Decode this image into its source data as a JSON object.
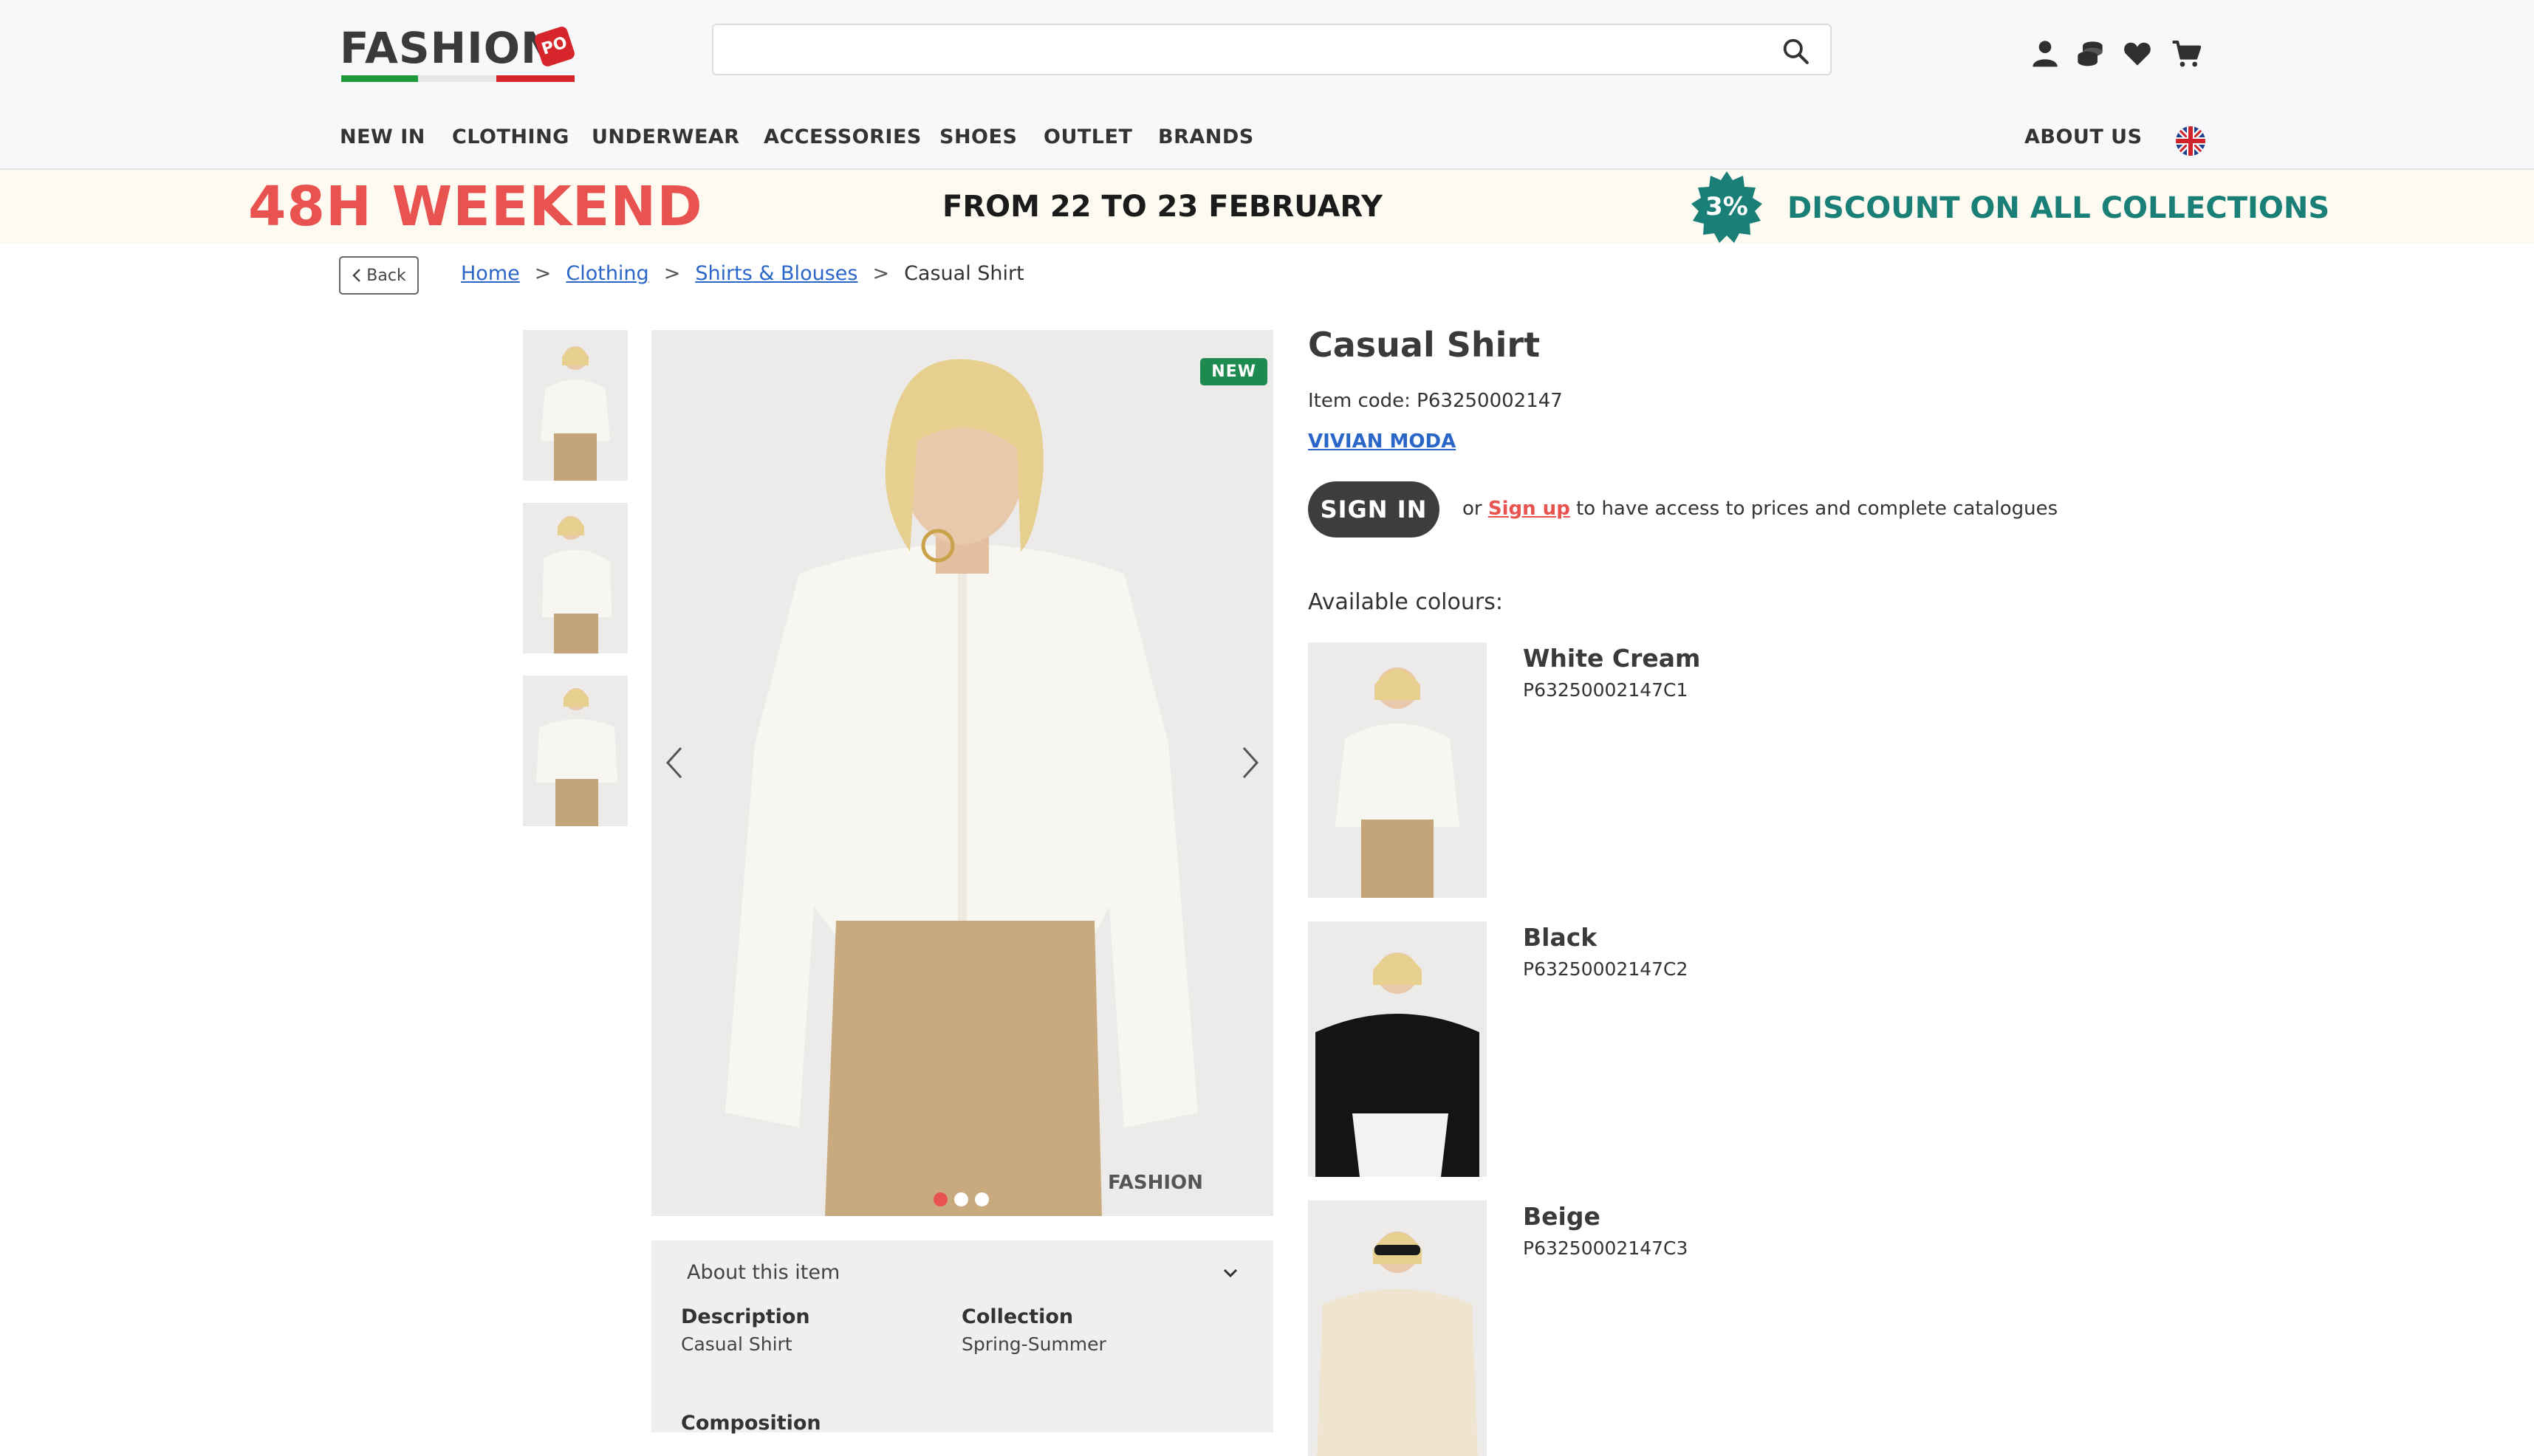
{
  "header": {
    "logo": {
      "text": "FASHION",
      "tag": "PO"
    },
    "search": {
      "placeholder": "",
      "value": ""
    },
    "icons": [
      "user-icon",
      "coins-icon",
      "heart-icon",
      "cart-icon"
    ],
    "nav": [
      "NEW IN",
      "CLOTHING",
      "UNDERWEAR",
      "ACCESSORIES",
      "SHOES",
      "OUTLET",
      "BRANDS"
    ],
    "about_us": "ABOUT US",
    "language_icon": "uk-flag-icon"
  },
  "promo": {
    "left": "48H WEEKEND",
    "middle": "FROM 22 TO 23 FEBRUARY",
    "badge": "3%",
    "right": "DISCOUNT ON ALL COLLECTIONS",
    "colors": {
      "left": "#e8534f",
      "right": "#1a7f77",
      "badge": "#1a7f77"
    }
  },
  "breadcrumb": {
    "back": "Back",
    "items": [
      "Home",
      "Clothing",
      "Shirts & Blouses",
      "Casual Shirt"
    ],
    "separator": ">"
  },
  "product": {
    "new_badge": "NEW",
    "watermark": "FASHION",
    "title": "Casual Shirt",
    "item_code": "Item code: P63250002147",
    "brand": "VIVIAN MODA",
    "signin": "SIGN IN",
    "signin_or": "or",
    "signup_link": "Sign up",
    "signin_suffix": "to have access to prices and complete catalogues",
    "colours_label": "Available colours:",
    "colours": [
      {
        "name": "White Cream",
        "code": "P63250002147C1"
      },
      {
        "name": "Black",
        "code": "P63250002147C2"
      },
      {
        "name": "Beige",
        "code": "P63250002147C3"
      }
    ],
    "carousel": {
      "count": 3,
      "active": 0
    }
  },
  "about": {
    "title": "About this item",
    "specs": [
      {
        "label": "Description",
        "value": "Casual Shirt"
      },
      {
        "label": "Collection",
        "value": "Spring-Summer"
      },
      {
        "label": "Composition",
        "value": ""
      }
    ]
  }
}
